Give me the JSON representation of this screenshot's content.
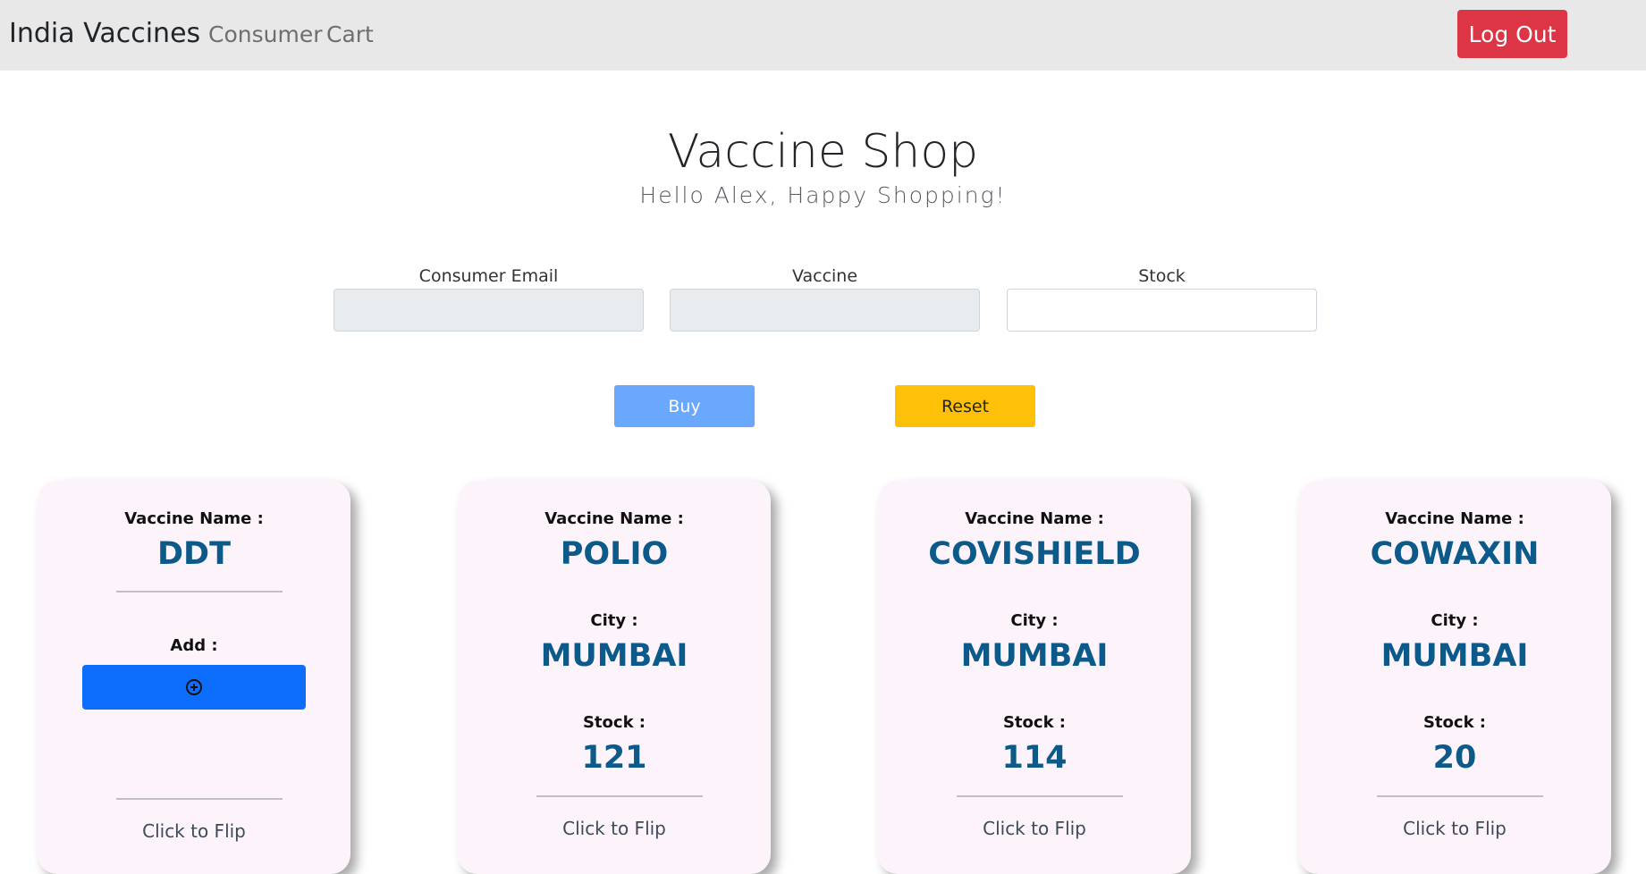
{
  "nav": {
    "brand": "India Vaccines",
    "links": [
      "Consumer",
      "Cart"
    ],
    "logout_label": "Log Out"
  },
  "header": {
    "title": "Vaccine Shop",
    "subtitle": "Hello Alex, Happy Shopping!"
  },
  "form": {
    "email_label": "Consumer Email",
    "email_value": "",
    "vaccine_label": "Vaccine",
    "vaccine_value": "",
    "stock_label": "Stock",
    "stock_value": "",
    "buy_label": "Buy",
    "reset_label": "Reset"
  },
  "labels": {
    "vaccine_name": "Vaccine Name :",
    "city": "City :",
    "stock": "Stock :",
    "add": "Add :",
    "flip": "Click to Flip"
  },
  "cards": [
    {
      "name": "DDT",
      "flipped": true
    },
    {
      "name": "POLIO",
      "city": "MUMBAI",
      "stock": "121"
    },
    {
      "name": "COVISHIELD",
      "city": "MUMBAI",
      "stock": "114"
    },
    {
      "name": "COWAXIN",
      "city": "MUMBAI",
      "stock": "20"
    }
  ],
  "colors": {
    "navbar": "#e8e8e8",
    "danger": "#dc3545",
    "primary": "#0d6efd",
    "warning": "#ffc107",
    "card_bg": "#fdf4fb",
    "card_value": "#0c5a8a"
  },
  "icons": {
    "add": "plus-circle-icon"
  }
}
